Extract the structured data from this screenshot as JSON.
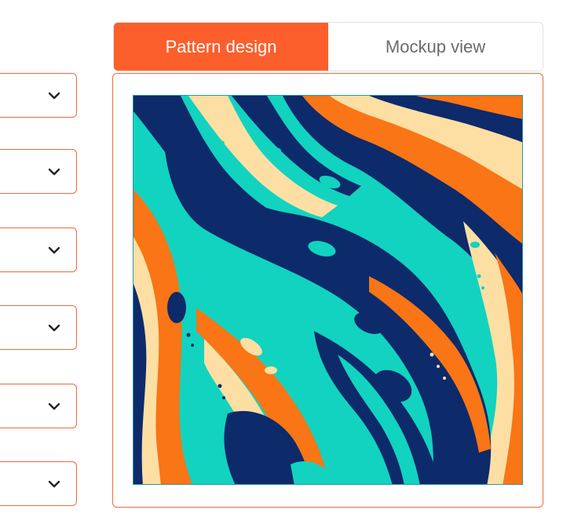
{
  "tabs": {
    "active": "Pattern design",
    "inactive": "Mockup view"
  },
  "dropdowns": [
    {
      "icon": "chevron-down-icon"
    },
    {
      "icon": "chevron-down-icon"
    },
    {
      "icon": "chevron-down-icon"
    },
    {
      "icon": "chevron-down-icon"
    },
    {
      "icon": "chevron-down-icon"
    },
    {
      "icon": "chevron-down-icon"
    }
  ],
  "pattern": {
    "colors": {
      "navy": "#0d2a6b",
      "teal": "#12d3bf",
      "orange": "#f97516",
      "cream": "#fddfa4"
    }
  },
  "accent": "#fc5f2c"
}
